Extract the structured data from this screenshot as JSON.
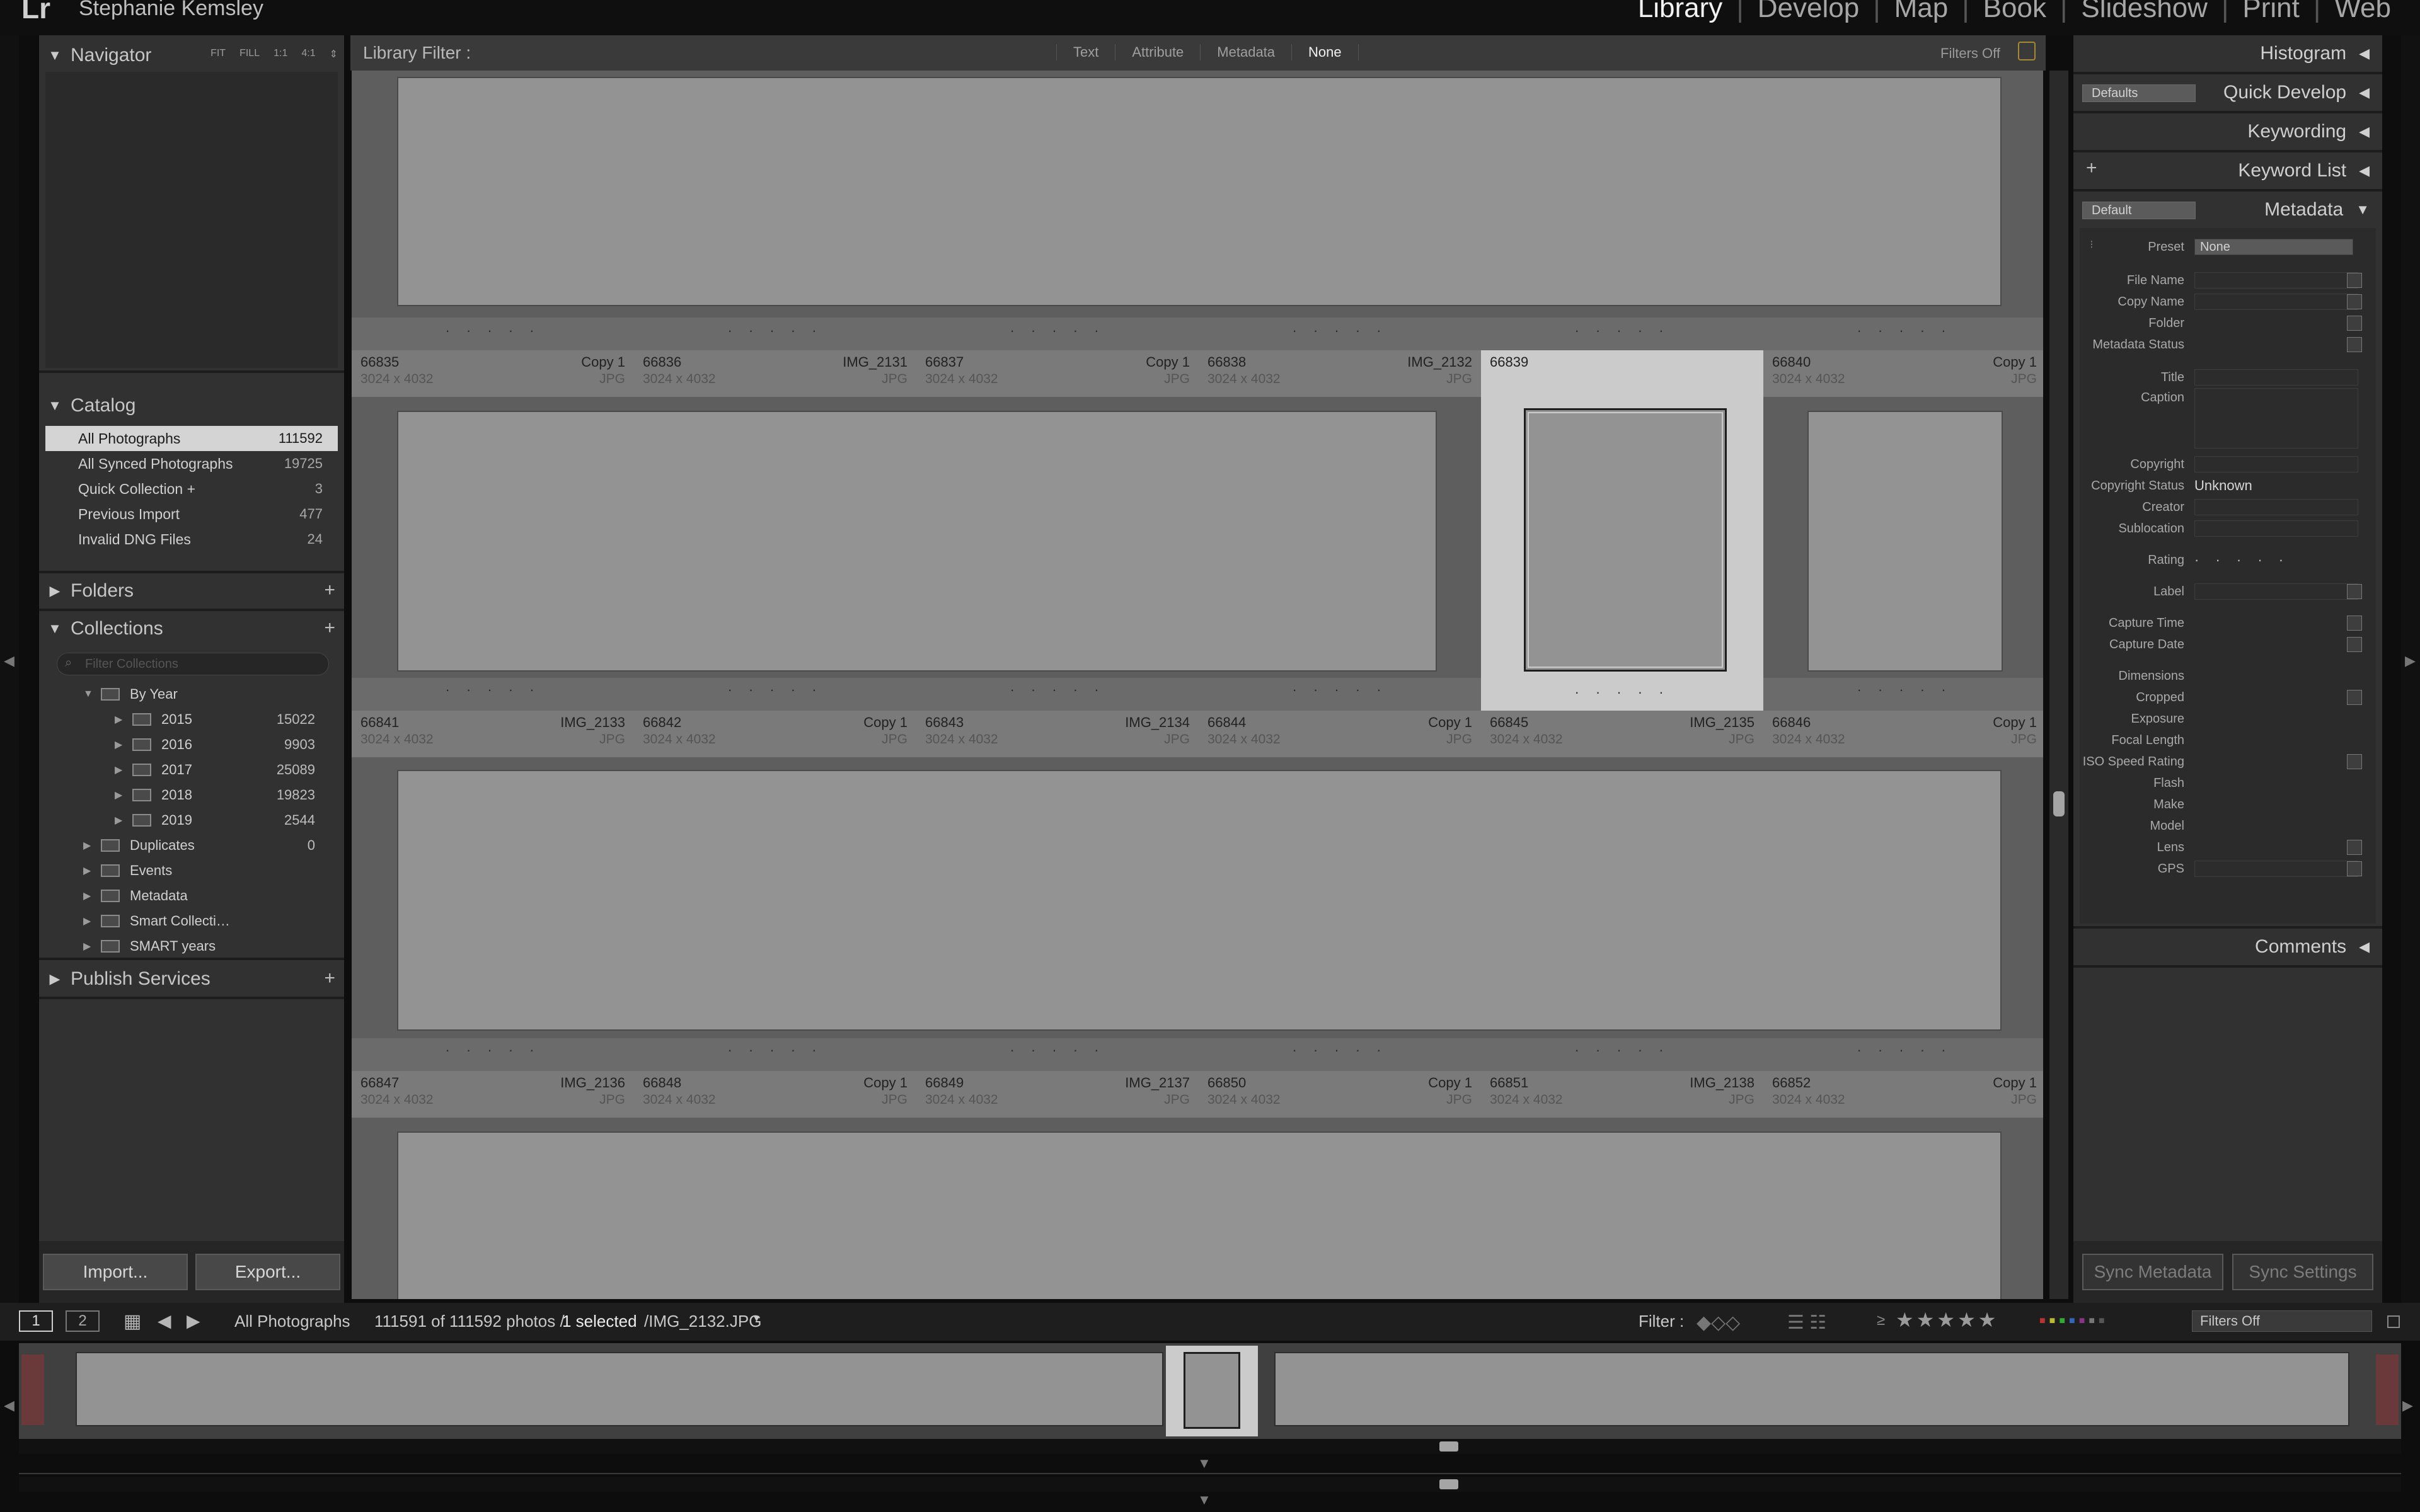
{
  "identity": {
    "user": "Stephanie Kemsley",
    "logo": "Lr"
  },
  "modules": [
    "Library",
    "Develop",
    "Map",
    "Book",
    "Slideshow",
    "Print",
    "Web"
  ],
  "active_module": "Library",
  "navigator": {
    "title": "Navigator",
    "zoom_options": [
      "FIT",
      "FILL",
      "1:1",
      "4:1"
    ]
  },
  "catalog": {
    "title": "Catalog",
    "items": [
      {
        "label": "All Photographs",
        "count": "111592"
      },
      {
        "label": "All Synced Photographs",
        "count": "19725"
      },
      {
        "label": "Quick Collection +",
        "count": "3"
      },
      {
        "label": "Previous Import",
        "count": "477"
      },
      {
        "label": "Invalid DNG Files",
        "count": "24"
      }
    ]
  },
  "folders": {
    "title": "Folders"
  },
  "collections": {
    "title": "Collections",
    "filter_placeholder": "Filter Collections",
    "by_year": "By Year",
    "years": [
      {
        "label": "2015",
        "count": "15022"
      },
      {
        "label": "2016",
        "count": "9903"
      },
      {
        "label": "2017",
        "count": "25089"
      },
      {
        "label": "2018",
        "count": "19823"
      },
      {
        "label": "2019",
        "count": "2544"
      }
    ],
    "sets": [
      {
        "label": "Duplicates",
        "count": "0"
      },
      {
        "label": "Events",
        "count": ""
      },
      {
        "label": "Metadata",
        "count": ""
      },
      {
        "label": "Smart Collecti…",
        "count": ""
      },
      {
        "label": "SMART years",
        "count": ""
      }
    ]
  },
  "publish_services": {
    "title": "Publish Services"
  },
  "left_buttons": {
    "import": "Import...",
    "export": "Export..."
  },
  "filter_bar": {
    "title": "Library Filter :",
    "options": [
      "Text",
      "Attribute",
      "Metadata",
      "None"
    ],
    "active": "None",
    "filters_off": "Filters Off"
  },
  "grid": {
    "rows": [
      [
        {
          "num": "66835",
          "name": "Copy 1",
          "dims": "3024 x 4032",
          "type": "JPG"
        },
        {
          "num": "66836",
          "name": "IMG_2131",
          "dims": "3024 x 4032",
          "type": "JPG"
        },
        {
          "num": "66837",
          "name": "Copy 1",
          "dims": "3024 x 4032",
          "type": "JPG"
        },
        {
          "num": "66838",
          "name": "IMG_2132",
          "dims": "3024 x 4032",
          "type": "JPG"
        },
        {
          "num": "66839",
          "name": "",
          "dims": "",
          "type": ""
        },
        {
          "num": "66840",
          "name": "Copy 1",
          "dims": "3024 x 4032",
          "type": "JPG"
        }
      ],
      [
        {
          "num": "66841",
          "name": "IMG_2133",
          "dims": "3024 x 4032",
          "type": "JPG"
        },
        {
          "num": "66842",
          "name": "Copy 1",
          "dims": "3024 x 4032",
          "type": "JPG"
        },
        {
          "num": "66843",
          "name": "IMG_2134",
          "dims": "3024 x 4032",
          "type": "JPG"
        },
        {
          "num": "66844",
          "name": "Copy 1",
          "dims": "3024 x 4032",
          "type": "JPG"
        },
        {
          "num": "66845",
          "name": "IMG_2135",
          "dims": "3024 x 4032",
          "type": "JPG"
        },
        {
          "num": "66846",
          "name": "Copy 1",
          "dims": "3024 x 4032",
          "type": "JPG"
        }
      ],
      [
        {
          "num": "66847",
          "name": "IMG_2136",
          "dims": "3024 x 4032",
          "type": "JPG"
        },
        {
          "num": "66848",
          "name": "Copy 1",
          "dims": "3024 x 4032",
          "type": "JPG"
        },
        {
          "num": "66849",
          "name": "IMG_2137",
          "dims": "3024 x 4032",
          "type": "JPG"
        },
        {
          "num": "66850",
          "name": "Copy 1",
          "dims": "3024 x 4032",
          "type": "JPG"
        },
        {
          "num": "66851",
          "name": "IMG_2138",
          "dims": "3024 x 4032",
          "type": "JPG"
        },
        {
          "num": "66852",
          "name": "Copy 1",
          "dims": "3024 x 4032",
          "type": "JPG"
        }
      ]
    ]
  },
  "right_panels": {
    "histogram": "Histogram",
    "quick_develop": "Quick Develop",
    "quick_develop_preset": "Defaults",
    "keywording": "Keywording",
    "keyword_list": "Keyword List",
    "metadata": "Metadata",
    "metadata_preset_select": "Default",
    "preset_label": "Preset",
    "preset_value": "None",
    "fields": [
      "File Name",
      "Copy Name",
      "Folder",
      "Metadata Status",
      "Title",
      "Caption",
      "Copyright",
      "Copyright Status",
      "Creator",
      "Sublocation",
      "Rating",
      "Label",
      "Capture Time",
      "Capture Date",
      "Dimensions",
      "Cropped",
      "Exposure",
      "Focal Length",
      "ISO Speed Rating",
      "Flash",
      "Make",
      "Model",
      "Lens",
      "GPS"
    ],
    "copyright_status_value": "Unknown",
    "comments": "Comments",
    "sync_metadata": "Sync Metadata",
    "sync_settings": "Sync Settings"
  },
  "toolbar": {
    "page1": "1",
    "page2": "2",
    "source": "All Photographs",
    "count_text": "111591 of 111592 photos /",
    "selected_text": "1 selected",
    "file_text": "/IMG_2132.JPG",
    "filter_label": "Filter :",
    "filters_off": "Filters Off"
  }
}
